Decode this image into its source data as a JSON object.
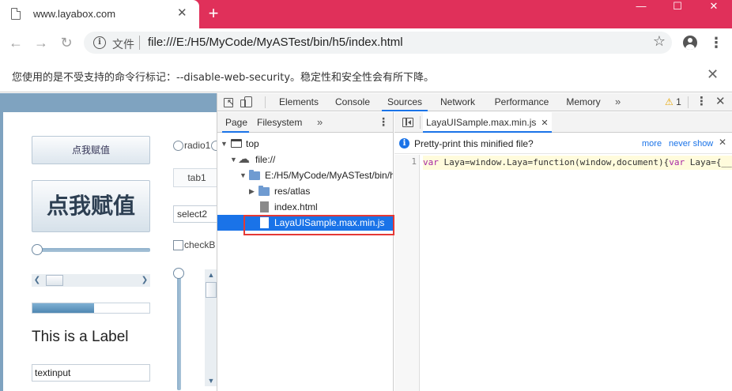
{
  "browser": {
    "tab_title": "www.layabox.com",
    "new_tab_glyph": "+",
    "tab_close_glyph": "✕",
    "window_controls": {
      "minimize": "—",
      "maximize": "☐",
      "close": "✕"
    },
    "address_scheme_label": "文件",
    "address_url": "file:///E:/H5/MyCode/MyASTest/bin/h5/index.html",
    "nav": {
      "back": "←",
      "forward": "→",
      "reload": "↻"
    },
    "star_glyph": "☆",
    "menu_glyph": "⋮",
    "info_glyph": "i"
  },
  "infobar": {
    "message": "您使用的是不受支持的命令行标记：--disable-web-security。稳定性和安全性会有所下降。",
    "close_glyph": "✕"
  },
  "page": {
    "button_small_label": "点我赋值",
    "button_big_label": "点我赋值",
    "radio_label": "radio1",
    "tab_label": "tab1",
    "select_value": "select2",
    "checkbox_label": "checkB",
    "progress_fraction": 0.53,
    "label_text": "This is a Label",
    "textinput_value": "textinput",
    "scroll_left": "❮",
    "scroll_right": "❯",
    "scroll_up": "▲",
    "scroll_down": "▼"
  },
  "devtools": {
    "tabs": [
      "Elements",
      "Console",
      "Sources",
      "Network",
      "Performance",
      "Memory"
    ],
    "active_tab": "Sources",
    "more_tabs_glyph": "»",
    "warning_count": "1",
    "warning_glyph": "⚠",
    "menu_glyph": "⋮",
    "close_glyph": "✕",
    "navigator": {
      "tabs": [
        "Page",
        "Filesystem"
      ],
      "more_glyph": "»",
      "menu_glyph": "⋮",
      "tree": {
        "top": "top",
        "origin": "file://",
        "folder": "E:/H5/MyCode/MyASTest/bin/h",
        "subfolder": "res/atlas",
        "file1": "index.html",
        "file2": "LayaUISample.max.min.js"
      },
      "expanded_glyph": "▼",
      "collapsed_glyph": "▶",
      "cloud_glyph": "☁"
    },
    "editor": {
      "open_file": "LayaUISample.max.min.js",
      "tab_close_glyph": "✕",
      "prettyprint_prompt": "Pretty-print this minified file?",
      "more_link": "more",
      "never_show_link": "never show",
      "bar_close_glyph": "✕",
      "info_glyph": "i",
      "line_number": "1",
      "code_keyword1": "var",
      "code_mid": " Laya=window.Laya=function(window,document){",
      "code_keyword2": "var",
      "code_tail": " Laya={__i"
    }
  }
}
